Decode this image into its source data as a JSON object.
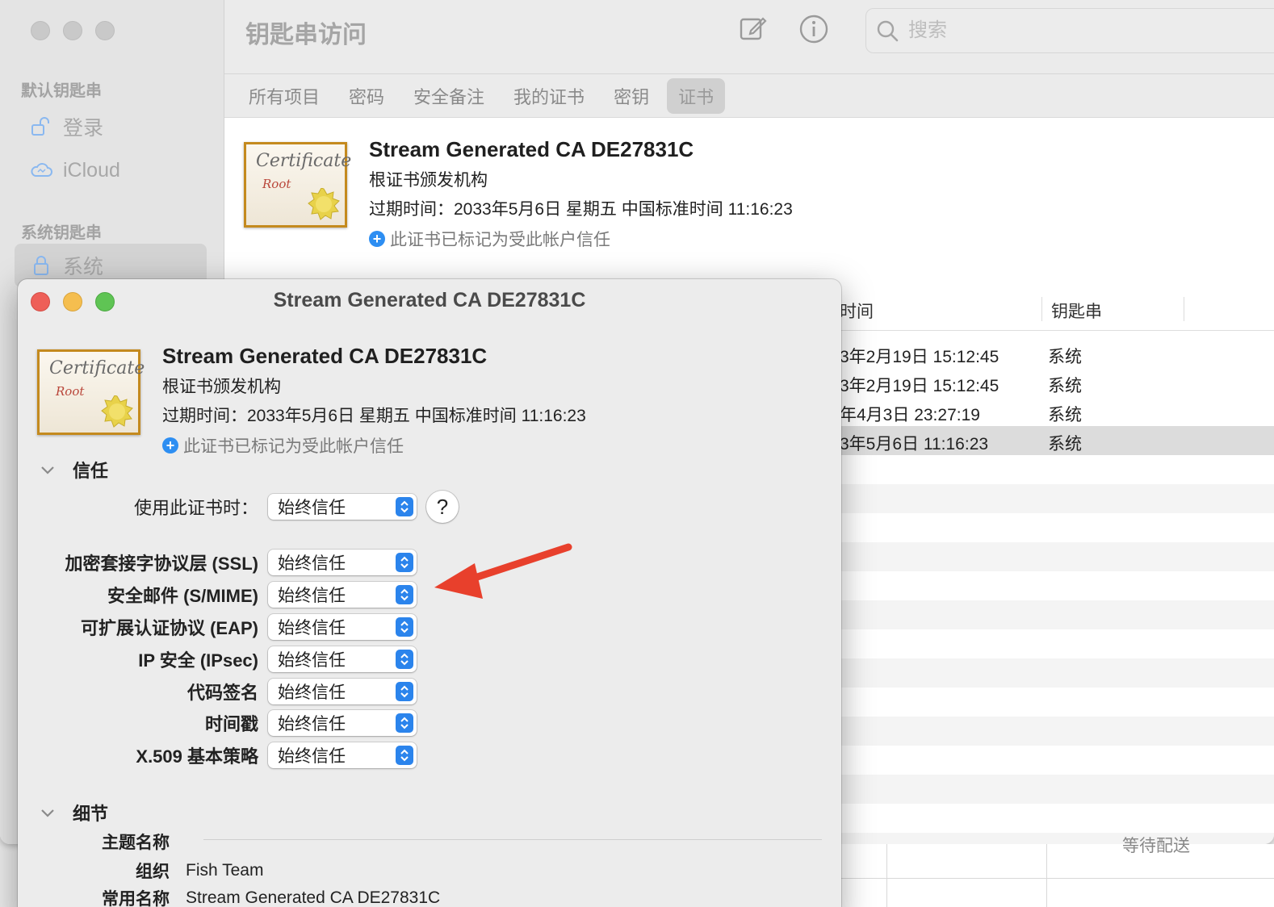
{
  "main_window": {
    "sidebar": {
      "section_default": "默认钥匙串",
      "section_system": "系统钥匙串",
      "items": [
        {
          "label": "登录",
          "icon": "unlock-icon"
        },
        {
          "label": "iCloud",
          "icon": "icloud-icon"
        },
        {
          "label": "系统",
          "icon": "lock-icon",
          "selected": true
        }
      ]
    },
    "toolbar": {
      "title": "钥匙串访问",
      "search_placeholder": "搜索"
    },
    "tabs": [
      {
        "label": "所有项目"
      },
      {
        "label": "密码"
      },
      {
        "label": "安全备注"
      },
      {
        "label": "我的证书"
      },
      {
        "label": "密钥"
      },
      {
        "label": "证书",
        "active": true
      }
    ],
    "cert_header": {
      "name": "Stream Generated CA DE27831C",
      "type": "根证书颁发机构",
      "expires": "过期时间：2033年5月6日 星期五 中国标准时间 11:16:23",
      "trust_note": "此证书已标记为受此帐户信任"
    },
    "list": {
      "columns": [
        "时间",
        "钥匙串"
      ],
      "rows": [
        {
          "date": "3年2月19日 15:12:45",
          "keychain": "系统"
        },
        {
          "date": "3年2月19日 15:12:45",
          "keychain": "系统"
        },
        {
          "date": "年4月3日 23:27:19",
          "keychain": "系统"
        },
        {
          "date": "3年5月6日 11:16:23",
          "keychain": "系统",
          "selected": true
        }
      ]
    },
    "footer_text": "等待配送"
  },
  "dialog": {
    "title": "Stream Generated CA DE27831C",
    "cert_header": {
      "name": "Stream Generated CA DE27831C",
      "type": "根证书颁发机构",
      "expires": "过期时间：2033年5月6日 星期五 中国标准时间 11:16:23",
      "trust_note": "此证书已标记为受此帐户信任"
    },
    "trust_section": {
      "heading": "信任",
      "use_label": "使用此证书时：",
      "use_value": "始终信任",
      "help_label": "?",
      "policies": [
        {
          "label": "加密套接字协议层 (SSL)",
          "value": "始终信任"
        },
        {
          "label": "安全邮件 (S/MIME)",
          "value": "始终信任"
        },
        {
          "label": "可扩展认证协议 (EAP)",
          "value": "始终信任"
        },
        {
          "label": "IP 安全 (IPsec)",
          "value": "始终信任"
        },
        {
          "label": "代码签名",
          "value": "始终信任"
        },
        {
          "label": "时间戳",
          "value": "始终信任"
        },
        {
          "label": "X.509 基本策略",
          "value": "始终信任"
        }
      ]
    },
    "details_section": {
      "heading": "细节",
      "subject_heading": "主题名称",
      "rows": [
        {
          "label": "组织",
          "value": "Fish Team"
        },
        {
          "label": "常用名称",
          "value": "Stream Generated CA DE27831C"
        }
      ]
    }
  },
  "cert_icon": {
    "text": "Certificate",
    "subtext": "Root"
  },
  "colors": {
    "accent_blue": "#2b84ec",
    "arrow_red": "#e8402c",
    "close_red": "#ee5f58",
    "minimize_yellow": "#f5be4f",
    "zoom_green": "#5fc454",
    "cert_border": "#c48a1e"
  }
}
